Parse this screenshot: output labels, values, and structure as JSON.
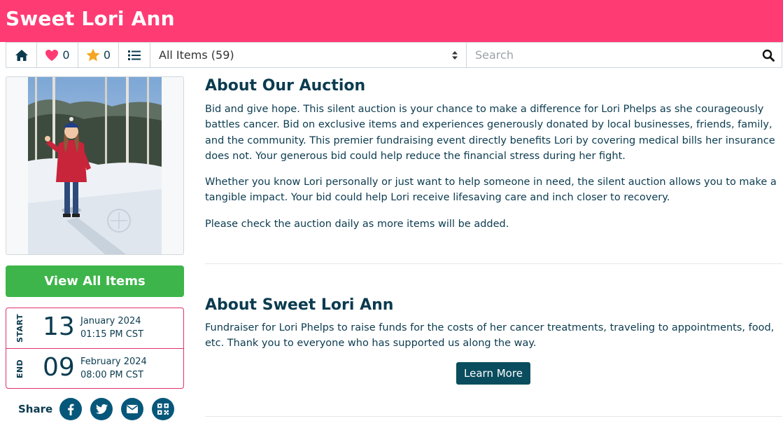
{
  "header": {
    "title": "Sweet Lori Ann"
  },
  "toolbar": {
    "favorites_count": "0",
    "watch_count": "0",
    "category_select": "All Items (59)",
    "search_placeholder": "Search"
  },
  "sidebar": {
    "view_all_label": "View All Items",
    "start": {
      "label": "START",
      "day": "13",
      "month_year": "January 2024",
      "time": "01:15 PM CST"
    },
    "end": {
      "label": "END",
      "day": "09",
      "month_year": "February 2024",
      "time": "08:00 PM CST"
    },
    "share_label": "Share",
    "share_icons": [
      "facebook-icon",
      "twitter-icon",
      "email-icon",
      "qr-code-icon"
    ]
  },
  "about_auction": {
    "title": "About Our Auction",
    "paragraphs": [
      "Bid and give hope. This silent auction is your chance to make a difference for Lori Phelps as she courageously battles cancer. Bid on exclusive items and experiences generously donated by local businesses, friends, family, and the community. This premier fundraising event directly benefits Lori by covering medical bills her insurance does not. Your generous bid could help reduce the financial stress during her fight.",
      "Whether you know Lori personally or just want to help someone in need, the silent auction allows you to make a tangible impact. Your bid could help Lori receive lifesaving care and inch closer to recovery.",
      "Please check the auction daily as more items will be added."
    ]
  },
  "about_org": {
    "title": "About Sweet Lori Ann",
    "paragraph": "Fundraiser for Lori Phelps to raise funds for the costs of her cancer treatments, traveling to appointments, food, etc. Thank you to everyone who has supported us along the way.",
    "learn_more_label": "Learn More"
  },
  "colors": {
    "header_bg": "#ff3b74",
    "primary_text": "#0b3b4f",
    "view_all_bg": "#3db54a",
    "date_border": "#e0306d",
    "share_bg": "#06577a",
    "learn_more_bg": "#0a4d5e"
  }
}
